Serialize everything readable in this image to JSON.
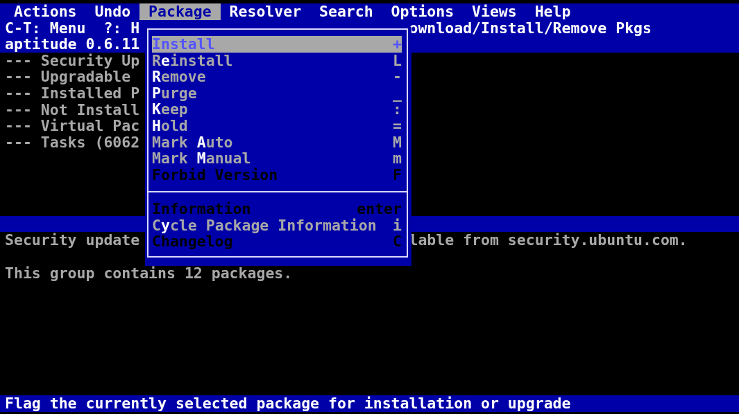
{
  "menu_bar": [
    {
      "label": "Actions",
      "selected": false
    },
    {
      "label": "Undo",
      "selected": false
    },
    {
      "label": "Package",
      "selected": true
    },
    {
      "label": "Resolver",
      "selected": false
    },
    {
      "label": "Search",
      "selected": false
    },
    {
      "label": "Options",
      "selected": false
    },
    {
      "label": "Views",
      "selected": false
    },
    {
      "label": "Help",
      "selected": false
    }
  ],
  "header": {
    "help_hint": "C-T: Menu  ?: H",
    "title_tail": "ownload/Install/Remove Pkgs",
    "version": "aptitude 0.6.11"
  },
  "package_tree": [
    "--- Security Up",
    "--- Upgradable ",
    "--- Installed P",
    "--- Not Install",
    "--- Virtual Pac",
    "--- Tasks (6062"
  ],
  "description": {
    "line_1_left": "Security update",
    "line_1_right": "lable from security.ubuntu.com.",
    "line_2": "This group contains 12 packages."
  },
  "package_menu": [
    {
      "kind": "item",
      "label": "Install",
      "shortcut": "+",
      "selected": true,
      "disabled": true
    },
    {
      "kind": "item",
      "label": "R**e**install",
      "shortcut": "L",
      "selected": false,
      "disabled": false
    },
    {
      "kind": "item",
      "label": "**R**emove",
      "shortcut": "-",
      "selected": false,
      "disabled": false
    },
    {
      "kind": "item",
      "label": "**P**urge",
      "shortcut": "_",
      "selected": false,
      "disabled": false
    },
    {
      "kind": "item",
      "label": "**K**eep",
      "shortcut": ":",
      "selected": false,
      "disabled": false
    },
    {
      "kind": "item",
      "label": "**H**old",
      "shortcut": "=",
      "selected": false,
      "disabled": false
    },
    {
      "kind": "item",
      "label": "Mark **A**uto",
      "shortcut": "M",
      "selected": false,
      "disabled": false
    },
    {
      "kind": "item",
      "label": "Mark **M**anual",
      "shortcut": "m",
      "selected": false,
      "disabled": false
    },
    {
      "kind": "item",
      "label": "Forbid Version",
      "shortcut": "F",
      "selected": false,
      "disabled": true
    },
    {
      "kind": "separator"
    },
    {
      "kind": "item",
      "label": "Information",
      "shortcut": "enter",
      "selected": false,
      "disabled": true
    },
    {
      "kind": "item",
      "label": "C**y**cle Package Information",
      "shortcut": "i",
      "selected": false,
      "disabled": false
    },
    {
      "kind": "item",
      "label": "Changelog",
      "shortcut": "C",
      "selected": false,
      "disabled": true
    }
  ],
  "status_bar": "Flag the currently selected package for installation or upgrade"
}
